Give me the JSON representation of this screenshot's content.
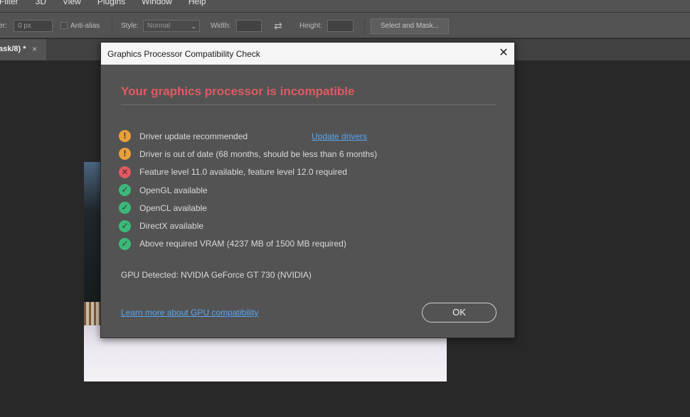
{
  "menubar": {
    "items": [
      "Filter",
      "3D",
      "View",
      "Plugins",
      "Window",
      "Help"
    ]
  },
  "options_bar": {
    "feather_label": "er:",
    "feather_value": "0 px",
    "antialias_label": "Anti-alias",
    "style_label": "Style:",
    "style_value": "Normal",
    "width_label": "Width:",
    "height_label": "Height:",
    "select_mask_label": "Select and Mask..."
  },
  "tabbar": {
    "doc_tab_label": "ask/8) *",
    "close_glyph": "×"
  },
  "dialog": {
    "title": "Graphics Processor Compatibility Check",
    "close_glyph": "✕",
    "heading": "Your graphics processor is incompatible",
    "checks": [
      {
        "status": "warning",
        "glyph": "!",
        "text": "Driver update recommended",
        "link": "Update drivers"
      },
      {
        "status": "warning",
        "glyph": "!",
        "text": "Driver is out of date (68 months, should be less than 6 months)"
      },
      {
        "status": "error",
        "glyph": "✕",
        "text": "Feature level 11.0 available, feature level 12.0 required"
      },
      {
        "status": "ok",
        "glyph": "✓",
        "text": "OpenGL available"
      },
      {
        "status": "ok",
        "glyph": "✓",
        "text": "OpenCL available"
      },
      {
        "status": "ok",
        "glyph": "✓",
        "text": "DirectX available"
      },
      {
        "status": "ok",
        "glyph": "✓",
        "text": "Above required VRAM (4237 MB of 1500 MB required)"
      }
    ],
    "gpu_detected": "GPU Detected: NVIDIA GeForce GT 730 (NVIDIA)",
    "learn_more": "Learn more about GPU compatibility",
    "ok_label": "OK"
  },
  "colors": {
    "error": "#e05a62",
    "warning": "#e8a03c",
    "ok": "#3db87a",
    "link": "#5aa6ee"
  }
}
